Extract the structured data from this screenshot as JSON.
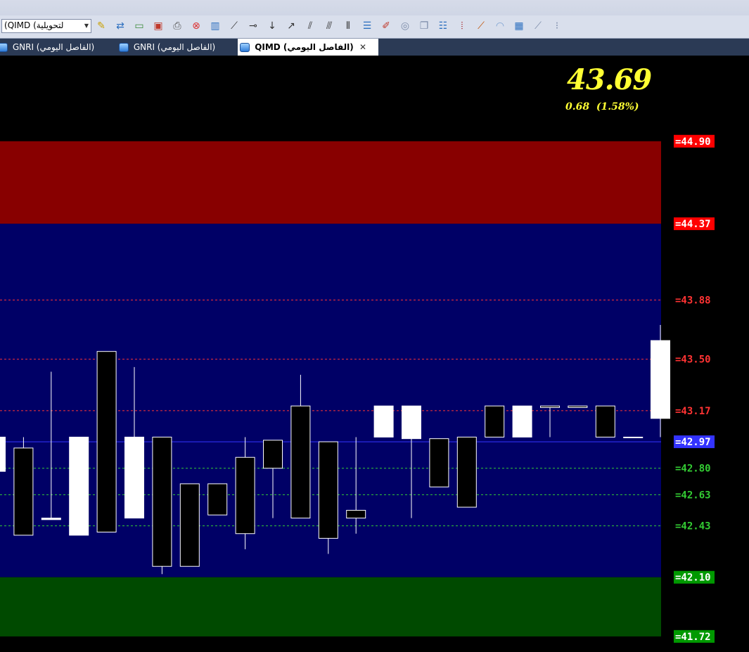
{
  "symbol_combo": {
    "value": "لتحويلية) QIMD)"
  },
  "toolbar": {
    "icons": [
      "wand-icon",
      "import-icon",
      "new-chart-icon",
      "chart-settings-icon",
      "print-icon",
      "stop-icon",
      "indicator-icon",
      "trendline-icon",
      "horizontal-line-icon",
      "vertical-line-icon",
      "ray-icon",
      "parallel-lines-icon",
      "channel-icon",
      "vertical-lines-icon",
      "fib-retracement-icon",
      "brush-icon",
      "circle-icon",
      "copy-icon",
      "layers-icon",
      "bars-icon",
      "gann-fan-icon",
      "arc-icon",
      "grid-icon",
      "speed-lines-icon",
      "fib-levels-icon"
    ]
  },
  "tabs": [
    {
      "label": "GNRI (الفاصل اليومي)",
      "active": false
    },
    {
      "label": "GNRI (الفاصل اليومي)",
      "active": false
    },
    {
      "label": "QIMD (الفاصل اليومي)",
      "active": true
    }
  ],
  "quote": {
    "price": "43.69",
    "change": "0.68",
    "change_pct": "(1.58%)"
  },
  "chart_data": {
    "type": "candlestick",
    "y_range": [
      41.62,
      45.45
    ],
    "zones": [
      {
        "from": 44.37,
        "to": 44.9,
        "color": "#880000"
      },
      {
        "from": 42.1,
        "to": 44.37,
        "color": "#000066"
      },
      {
        "from": 41.72,
        "to": 42.1,
        "color": "#004a00"
      }
    ],
    "levels": [
      {
        "value": 44.9,
        "label": "=44.90",
        "style": "box",
        "color": "#ff0000",
        "text_color": "#ffffff"
      },
      {
        "value": 44.37,
        "label": "=44.37",
        "style": "box",
        "color": "#ff0000",
        "text_color": "#ffffff"
      },
      {
        "value": 43.88,
        "label": "=43.88",
        "style": "dashed",
        "color": "#ff3333"
      },
      {
        "value": 43.5,
        "label": "=43.50",
        "style": "dashed",
        "color": "#ff3333"
      },
      {
        "value": 43.17,
        "label": "=43.17",
        "style": "dashed",
        "color": "#ff3333"
      },
      {
        "value": 42.97,
        "label": "=42.97",
        "style": "solid-box",
        "color": "#3333ff",
        "text_color": "#ffffff"
      },
      {
        "value": 42.8,
        "label": "=42.80",
        "style": "dashed",
        "color": "#33cc33"
      },
      {
        "value": 42.63,
        "label": "=42.63",
        "style": "dashed",
        "color": "#33cc33"
      },
      {
        "value": 42.43,
        "label": "=42.43",
        "style": "dashed",
        "color": "#33cc33"
      },
      {
        "value": 42.1,
        "label": "=42.10",
        "style": "box",
        "color": "#009900",
        "text_color": "#ffffff"
      },
      {
        "value": 41.72,
        "label": "=41.72",
        "style": "box",
        "color": "#009900",
        "text_color": "#ffffff"
      }
    ],
    "candles": [
      {
        "open": 42.78,
        "close": 43.0,
        "high": 43.0,
        "low": 42.78
      },
      {
        "open": 42.93,
        "close": 42.37,
        "high": 43.0,
        "low": 42.37
      },
      {
        "open": 42.47,
        "close": 42.48,
        "high": 43.42,
        "low": 42.47
      },
      {
        "open": 42.37,
        "close": 43.0,
        "high": 43.0,
        "low": 42.37
      },
      {
        "open": 43.55,
        "close": 42.39,
        "high": 43.55,
        "low": 42.39
      },
      {
        "open": 42.48,
        "close": 43.0,
        "high": 43.45,
        "low": 42.48
      },
      {
        "open": 43.0,
        "close": 42.17,
        "high": 43.0,
        "low": 42.12
      },
      {
        "open": 42.7,
        "close": 42.17,
        "high": 42.7,
        "low": 42.17
      },
      {
        "open": 42.7,
        "close": 42.5,
        "high": 42.7,
        "low": 42.5
      },
      {
        "open": 42.87,
        "close": 42.38,
        "high": 43.0,
        "low": 42.28
      },
      {
        "open": 42.98,
        "close": 42.8,
        "high": 42.98,
        "low": 42.48
      },
      {
        "open": 43.2,
        "close": 42.48,
        "high": 43.4,
        "low": 42.48
      },
      {
        "open": 42.97,
        "close": 42.35,
        "high": 42.97,
        "low": 42.25
      },
      {
        "open": 42.53,
        "close": 42.48,
        "high": 43.0,
        "low": 42.38
      },
      {
        "open": 43.0,
        "close": 43.2,
        "high": 43.2,
        "low": 43.0
      },
      {
        "open": 42.99,
        "close": 43.2,
        "high": 43.2,
        "low": 42.48
      },
      {
        "open": 42.99,
        "close": 42.68,
        "high": 42.99,
        "low": 42.68
      },
      {
        "open": 43.0,
        "close": 42.55,
        "high": 43.0,
        "low": 42.55
      },
      {
        "open": 43.2,
        "close": 43.0,
        "high": 43.2,
        "low": 43.0
      },
      {
        "open": 43.0,
        "close": 43.2,
        "high": 43.2,
        "low": 43.0
      },
      {
        "open": 43.2,
        "close": 43.19,
        "high": 43.2,
        "low": 43.0
      },
      {
        "open": 43.2,
        "close": 43.19,
        "high": 43.2,
        "low": 43.19
      },
      {
        "open": 43.2,
        "close": 43.0,
        "high": 43.2,
        "low": 43.0
      },
      {
        "open": 43.0,
        "close": 43.0,
        "high": 43.0,
        "low": 43.0
      },
      {
        "open": 43.12,
        "close": 43.62,
        "high": 43.72,
        "low": 43.0
      }
    ]
  }
}
